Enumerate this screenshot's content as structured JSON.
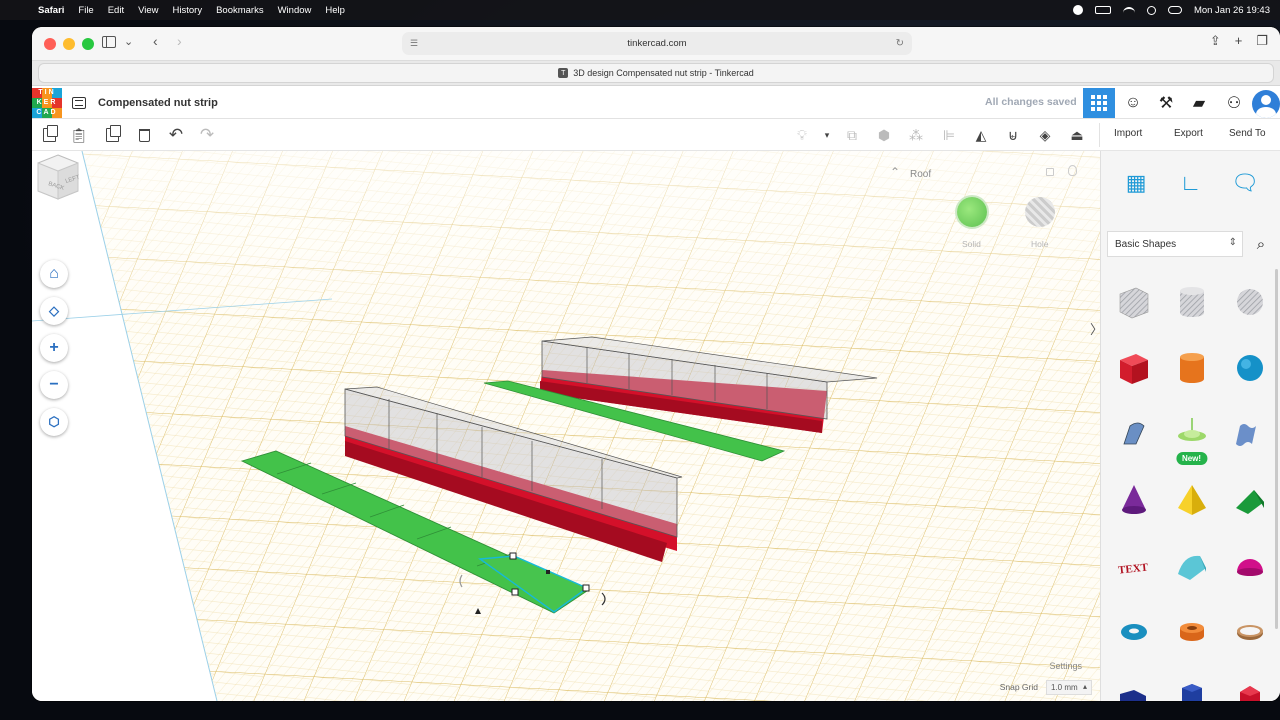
{
  "menubar": {
    "apple": "",
    "items": [
      "Safari",
      "File",
      "Edit",
      "View",
      "History",
      "Bookmarks",
      "Window",
      "Help"
    ],
    "clock": "Mon Jan 26  19:43"
  },
  "browser": {
    "url": "tinkercad.com",
    "tab_title": "3D design Compensated nut strip - Tinkercad",
    "tab_favicon": "T"
  },
  "app": {
    "logo_letters": [
      "TIN",
      "KER",
      "CAD"
    ],
    "design_title": "Compensated nut strip",
    "save_status": "All changes saved"
  },
  "toolbar": {
    "import_label": "Import",
    "export_label": "Export",
    "send_to_label": "Send To"
  },
  "inspector": {
    "group_label": "Roof",
    "solid_label": "Solid",
    "hole_label": "Hole"
  },
  "viewport": {
    "view_cube_faces": [
      "BACK",
      "LEFT"
    ],
    "settings_label": "Settings",
    "snap_grid_label": "Snap Grid",
    "snap_grid_value": "1.0 mm"
  },
  "shapes_panel": {
    "library": "Basic Shapes",
    "new_badge": "New!",
    "shapes": [
      "box-hole",
      "cylinder-hole",
      "sphere-hole",
      "box",
      "cylinder",
      "sphere",
      "scribble",
      "roof-new",
      "tiny-letters",
      "cone",
      "pyramid",
      "wedge",
      "text",
      "half-sphere",
      "paraboloid",
      "torus",
      "tube",
      "ring",
      "hexagonal-prism",
      "polygon",
      "gem"
    ]
  },
  "colors": {
    "accent_blue": "#2f8fe0",
    "solid_green": "#43c24a",
    "nut_red": "#d4102a",
    "grid_yellow": "#e6c96a"
  }
}
